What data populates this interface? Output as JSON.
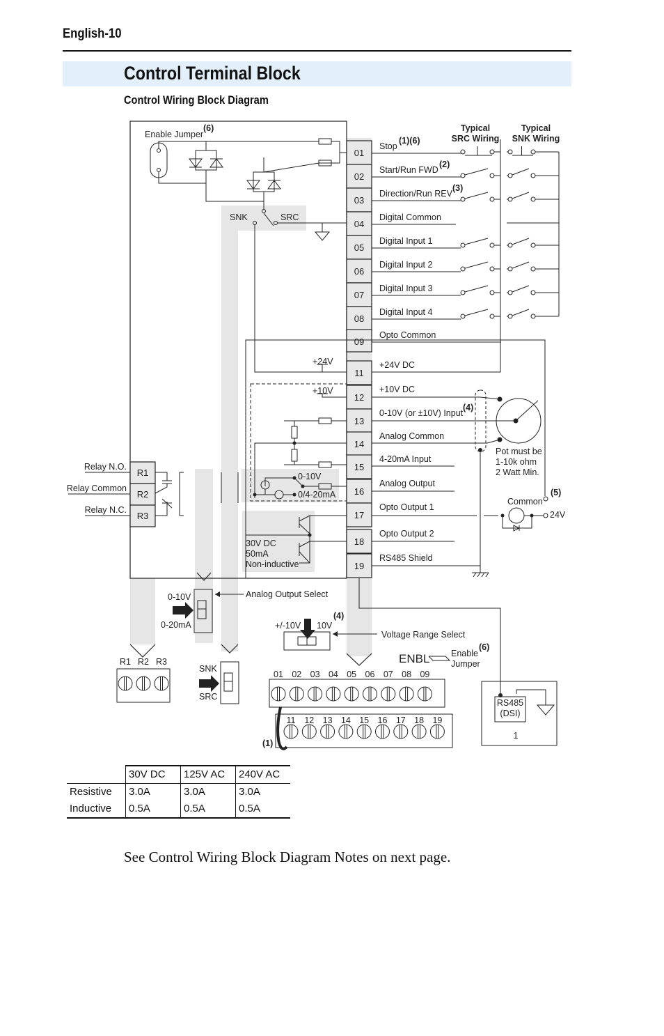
{
  "header": {
    "page_number": "English-10",
    "section_title": "Control Terminal Block",
    "subtitle": "Control Wiring Block Diagram"
  },
  "diagram": {
    "enable_jumper_label": "Enable Jumper",
    "enable_jumper_note": "(6)",
    "snk_label": "SNK",
    "src_label": "SRC",
    "typical_src_wiring": [
      "Typical",
      "SRC Wiring"
    ],
    "typical_snk_wiring": [
      "Typical",
      "SNK Wiring"
    ],
    "terminals": [
      {
        "num": "01",
        "label": "Stop",
        "note": "(1)(6)"
      },
      {
        "num": "02",
        "label": "Start/Run FWD",
        "note": "(2)"
      },
      {
        "num": "03",
        "label": "Direction/Run REV",
        "note": "(3)"
      },
      {
        "num": "04",
        "label": "Digital Common",
        "note": ""
      },
      {
        "num": "05",
        "label": "Digital Input 1",
        "note": ""
      },
      {
        "num": "06",
        "label": "Digital Input 2",
        "note": ""
      },
      {
        "num": "07",
        "label": "Digital Input 3",
        "note": ""
      },
      {
        "num": "08",
        "label": "Digital Input 4",
        "note": ""
      },
      {
        "num": "09",
        "label": "Opto Common",
        "note": ""
      },
      {
        "num": "11",
        "label": "+24V DC",
        "note": ""
      },
      {
        "num": "12",
        "label": "+10V DC",
        "note": ""
      },
      {
        "num": "13",
        "label": "0-10V (or ±10V) Input",
        "note": "(4)"
      },
      {
        "num": "14",
        "label": "Analog Common",
        "note": ""
      },
      {
        "num": "15",
        "label": "4-20mA Input",
        "note": ""
      },
      {
        "num": "16",
        "label": "Analog Output",
        "note": ""
      },
      {
        "num": "17",
        "label": "Opto Output 1",
        "note": ""
      },
      {
        "num": "18",
        "label": "Opto Output 2",
        "note": ""
      },
      {
        "num": "19",
        "label": "RS485 Shield",
        "note": ""
      }
    ],
    "relays": [
      {
        "num": "R1",
        "label": "Relay N.O."
      },
      {
        "num": "R2",
        "label": "Relay Common"
      },
      {
        "num": "R3",
        "label": "Relay N.C."
      }
    ],
    "supply_24v": "+24V",
    "supply_10v": "+10V",
    "analog_out_0_10v": "0-10V",
    "analog_out_0_4_20ma": "0/4-20mA",
    "opto_rating": [
      "30V DC",
      "50mA",
      "Non-inductive"
    ],
    "pot_note": [
      "Pot must be",
      "1-10k ohm",
      "2 Watt Min."
    ],
    "common_label": "Common",
    "common_note": "(5)",
    "v24_label": "24V",
    "analog_output_select": "Analog Output Select",
    "aos_0_10v": "0-10V",
    "aos_0_20ma": "0-20mA",
    "voltage_range_select": "Voltage Range Select",
    "vrs_pm10v": "+/-10V",
    "vrs_10v": "10V",
    "vrs_note": "(4)",
    "snk_switch": "SNK",
    "src_switch": "SRC",
    "enbl": "ENBL",
    "enable_jumper_lines": [
      "Enable",
      "Jumper"
    ],
    "enable_jumper_bottom_note": "(6)",
    "rs485_lines": [
      "RS485",
      "(DSI)"
    ],
    "rs485_pin": "1",
    "jumper_note": "(1)",
    "top_row_terminals": [
      "01",
      "02",
      "03",
      "04",
      "05",
      "06",
      "07",
      "08",
      "09"
    ],
    "bottom_row_terminals": [
      "11",
      "12",
      "13",
      "14",
      "15",
      "16",
      "17",
      "18",
      "19"
    ],
    "relay_block_labels": [
      "R1",
      "R2",
      "R3"
    ]
  },
  "ratings_table": {
    "columns": [
      "",
      "30V DC",
      "125V AC",
      "240V AC"
    ],
    "rows": [
      [
        "Resistive",
        "3.0A",
        "3.0A",
        "3.0A"
      ],
      [
        "Inductive",
        "0.5A",
        "0.5A",
        "0.5A"
      ]
    ]
  },
  "footer_note": "See Control Wiring Block Diagram Notes on next page."
}
